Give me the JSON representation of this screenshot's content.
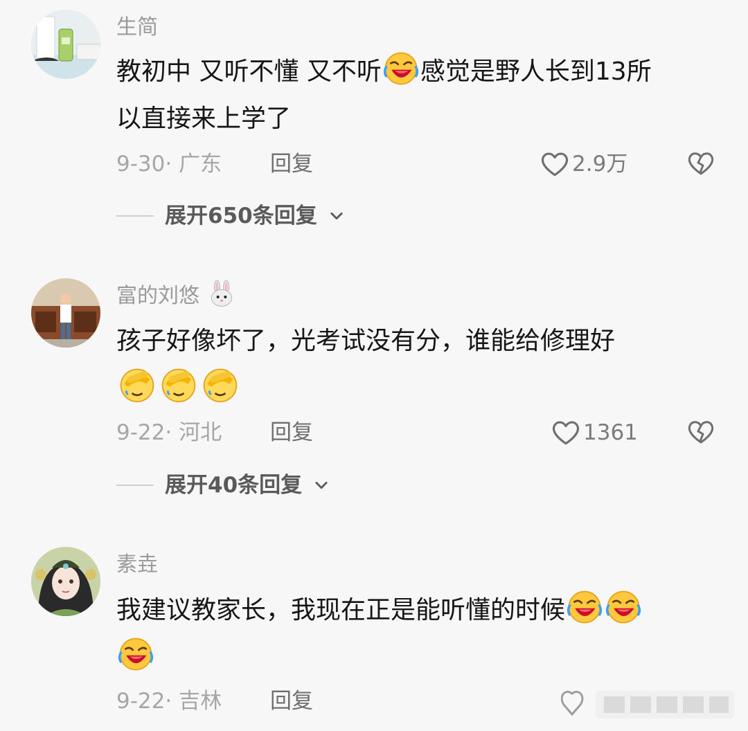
{
  "comments": [
    {
      "username": "生简",
      "text_line1": "教初中 又听不懂 又不听",
      "text_line1b": "感觉是野人长到13所",
      "text_line2": "以直接来上学了",
      "date_region": "9-30· 广东",
      "reply_label": "回复",
      "likes": "2.9万",
      "expand_label": "展开650条回复"
    },
    {
      "username": "富的刘悠",
      "text_line1": "孩子好像坏了，光考试没有分，谁能给修理好",
      "date_region": "9-22· 河北",
      "reply_label": "回复",
      "likes": "1361",
      "expand_label": "展开40条回复"
    },
    {
      "username": "素垚",
      "text_line1": "我建议教家长，我现在正是能听懂的时候",
      "date_region": "9-22· 吉林",
      "reply_label": "回复"
    }
  ],
  "icons": {
    "like": "heart-outline-icon",
    "dislike": "broken-heart-icon",
    "expand": "chevron-down-icon",
    "emoji_laugh": "laughing-crying-emoji",
    "emoji_facepalm": "facepalm-emoji",
    "emoji_rabbit": "rabbit-face-emoji"
  },
  "colors": {
    "background": "#f7f7f7",
    "text": "#161616",
    "meta": "#a6a6a6"
  }
}
